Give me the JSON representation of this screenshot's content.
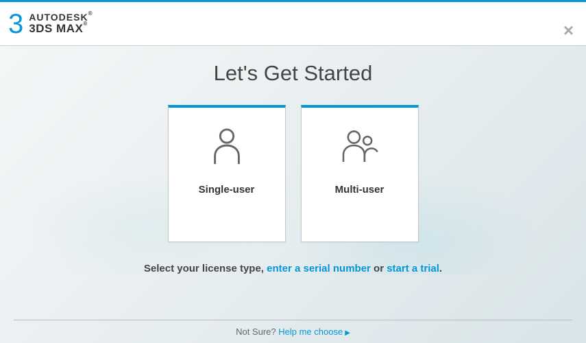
{
  "header": {
    "brand_icon_text": "3",
    "brand_line1": "AUTODESK",
    "brand_line2": "3DS MAX"
  },
  "main": {
    "title": "Let's Get Started",
    "cards": [
      {
        "label": "Single-user"
      },
      {
        "label": "Multi-user"
      }
    ],
    "instruction": {
      "prefix": "Select your license type, ",
      "link1": "enter a serial number",
      "middle": " or ",
      "link2": "start a trial",
      "suffix": "."
    }
  },
  "footer": {
    "prefix": "Not Sure? ",
    "link": "Help me choose"
  }
}
